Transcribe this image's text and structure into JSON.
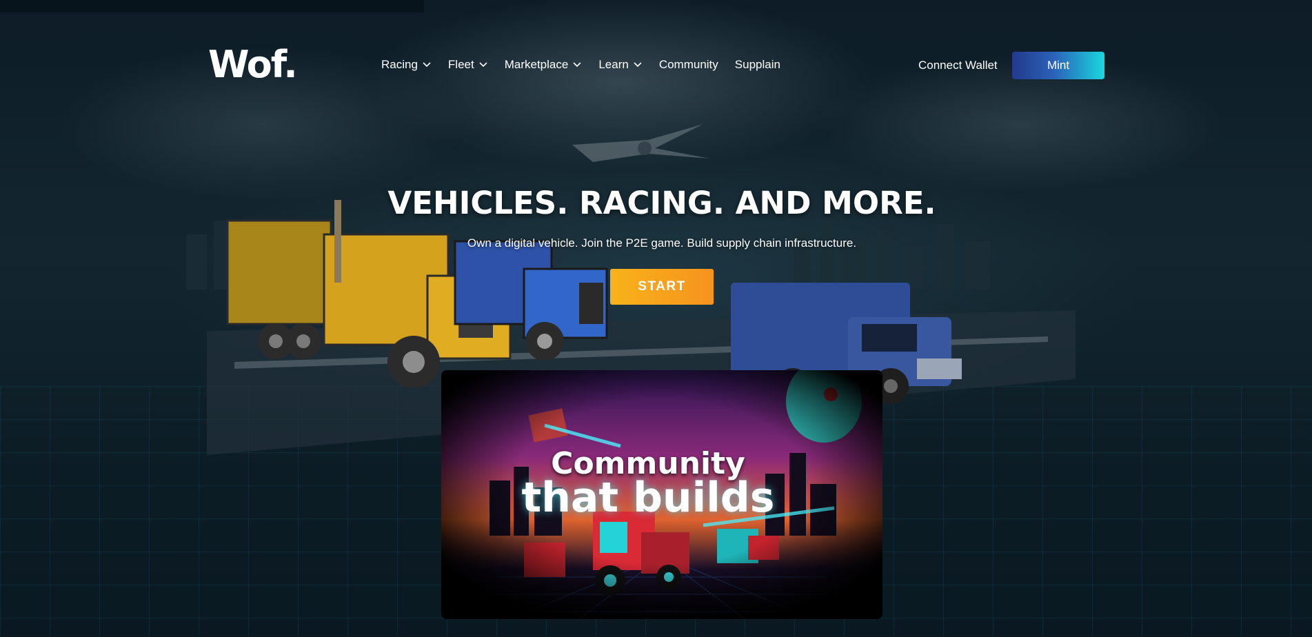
{
  "header": {
    "logo_text": "Wof.",
    "nav": [
      {
        "label": "Racing",
        "has_dropdown": true
      },
      {
        "label": "Fleet",
        "has_dropdown": true
      },
      {
        "label": "Marketplace",
        "has_dropdown": true
      },
      {
        "label": "Learn",
        "has_dropdown": true
      },
      {
        "label": "Community",
        "has_dropdown": false
      },
      {
        "label": "Supplain",
        "has_dropdown": false
      }
    ],
    "connect_wallet_label": "Connect Wallet",
    "mint_label": "Mint"
  },
  "hero": {
    "headline": "VEHICLES. RACING. AND MORE.",
    "subtext": "Own a digital vehicle. Join the P2E game. Build supply chain infrastructure.",
    "start_label": "START"
  },
  "video_card": {
    "title_line1": "Community",
    "title_line2": "that builds"
  },
  "colors": {
    "background": "#0d1c26",
    "mint_gradient_start": "#24398e",
    "mint_gradient_end": "#19d7de",
    "start_gradient_start": "#f8b21a",
    "start_gradient_end": "#f6931e"
  }
}
